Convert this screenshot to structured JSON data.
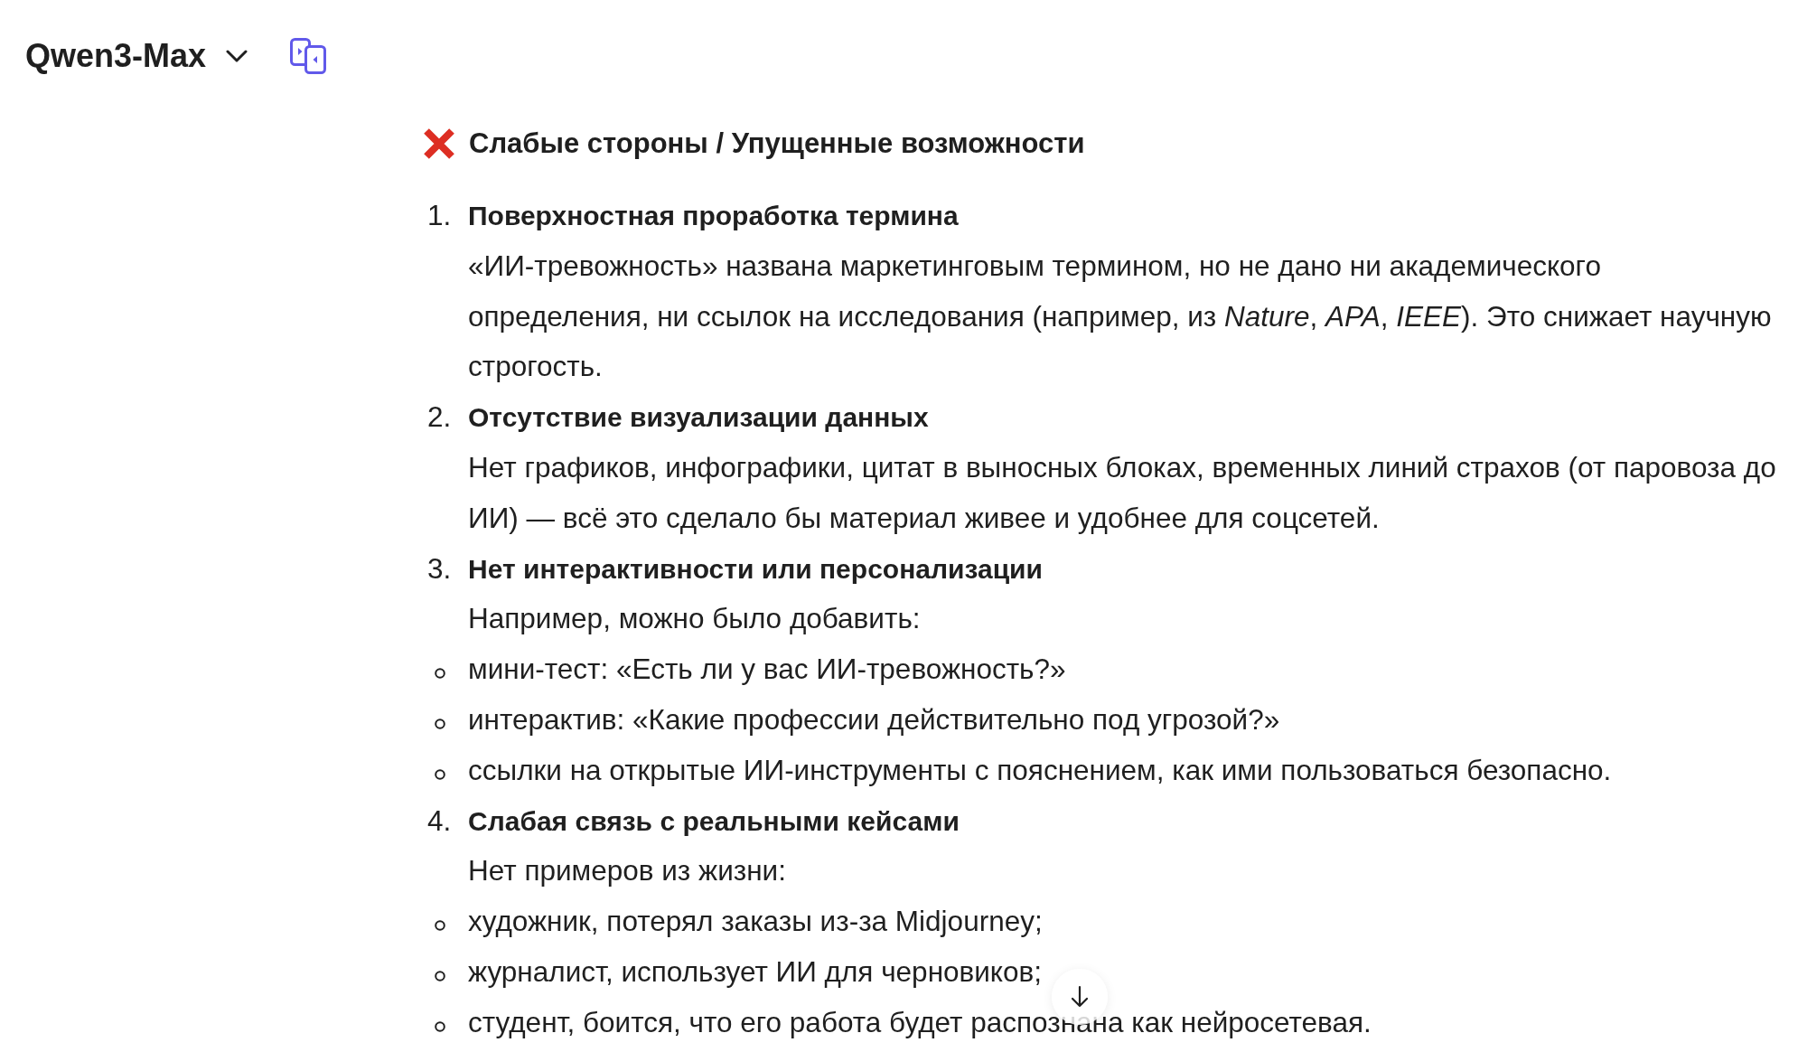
{
  "header": {
    "model_name": "Qwen3-Max"
  },
  "section": {
    "heading": "Слабые стороны / Упущенные возможности",
    "items": [
      {
        "number": "1.",
        "title": "Поверхностная проработка термина",
        "text": "«ИИ-тревожность» названа маркетинговым термином, но не дано ни академического определения, ни ссылок на исследования (например, из *Nature*, *APA*, *IEEE*). Это снижает научную строгость."
      },
      {
        "number": "2.",
        "title": "Отсутствие визуализации данных",
        "text": "Нет графиков, инфографики, цитат в выносных блоках, временных линий страхов (от паровоза до ИИ) — всё это сделало бы материал живее и удобнее для соцсетей."
      },
      {
        "number": "3.",
        "title": "Нет интерактивности или персонализации",
        "text": "Например, можно было добавить:",
        "bullets": [
          "мини-тест: «Есть ли у вас ИИ-тревожность?»",
          "интерактив: «Какие профессии действительно под угрозой?»",
          "ссылки на открытые ИИ-инструменты с пояснением, как ими пользоваться безопасно."
        ]
      },
      {
        "number": "4.",
        "title": "Слабая связь с реальными кейсами",
        "text": "Нет примеров из жизни:",
        "bullets": [
          "художник, потерял заказы из-за Midjourney;",
          "журналист, использует ИИ для черновиков;",
          "студент, боится, что его работа будет распознана как нейросетевая."
        ]
      }
    ]
  }
}
